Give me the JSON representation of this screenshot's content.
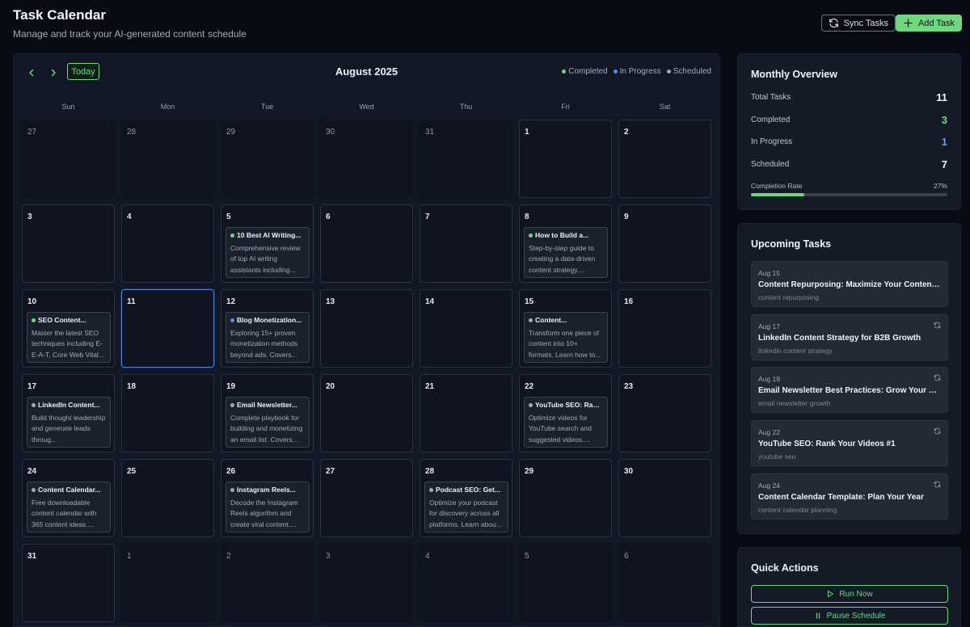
{
  "header": {
    "title": "Task Calendar",
    "subtitle": "Manage and track your AI-generated content schedule",
    "sync_label": "Sync Tasks",
    "add_label": "Add Task"
  },
  "calendar": {
    "month_label": "August 2025",
    "today_label": "Today",
    "legend": [
      {
        "label": "Completed",
        "color": "#6ed77f"
      },
      {
        "label": "In Progress",
        "color": "#5b8de0"
      },
      {
        "label": "Scheduled",
        "color": "#a3a9b5"
      }
    ],
    "weekdays": [
      "Sun",
      "Mon",
      "Tue",
      "Wed",
      "Thu",
      "Fri",
      "Sat"
    ],
    "days": [
      {
        "num": "27",
        "other": true
      },
      {
        "num": "28",
        "other": true
      },
      {
        "num": "29",
        "other": true
      },
      {
        "num": "30",
        "other": true
      },
      {
        "num": "31",
        "other": true
      },
      {
        "num": "1"
      },
      {
        "num": "2"
      },
      {
        "num": "3"
      },
      {
        "num": "4"
      },
      {
        "num": "5",
        "task": {
          "title": "10 Best AI Writing...",
          "desc": "Comprehensive review of top AI writing assistants including...",
          "status": "completed"
        }
      },
      {
        "num": "6"
      },
      {
        "num": "7"
      },
      {
        "num": "8",
        "task": {
          "title": "How to Build a...",
          "desc": "Step-by-step guide to creating a data-driven content strategy....",
          "status": "completed"
        }
      },
      {
        "num": "9"
      },
      {
        "num": "10",
        "task": {
          "title": "SEO Content...",
          "desc": "Master the latest SEO techniques including E-E-A-T, Core Web Vital...",
          "status": "completed"
        }
      },
      {
        "num": "11",
        "today": true
      },
      {
        "num": "12",
        "task": {
          "title": "Blog Monetization...",
          "desc": "Exploring 15+ proven monetization methods beyond ads. Covers...",
          "status": "in_progress"
        }
      },
      {
        "num": "13"
      },
      {
        "num": "14"
      },
      {
        "num": "15",
        "task": {
          "title": "Content...",
          "desc": "Transform one piece of content into 10+ formats. Learn how to...",
          "status": "scheduled"
        }
      },
      {
        "num": "16"
      },
      {
        "num": "17",
        "task": {
          "title": "LinkedIn Content...",
          "desc": "Build thought leadership and generate leads throug...",
          "status": "scheduled"
        }
      },
      {
        "num": "18"
      },
      {
        "num": "19",
        "task": {
          "title": "Email Newsletter...",
          "desc": "Complete playbook for building and monetizing an email list. Covers...",
          "status": "scheduled"
        }
      },
      {
        "num": "20"
      },
      {
        "num": "21"
      },
      {
        "num": "22",
        "task": {
          "title": "YouTube SEO: Rank...",
          "desc": "Optimize videos for YouTube search and suggested videos....",
          "status": "scheduled"
        }
      },
      {
        "num": "23"
      },
      {
        "num": "24",
        "task": {
          "title": "Content Calendar...",
          "desc": "Free downloadable content calendar with 365 content ideas....",
          "status": "scheduled"
        }
      },
      {
        "num": "25"
      },
      {
        "num": "26",
        "task": {
          "title": "Instagram Reels...",
          "desc": "Decode the Instagram Reels algorithm and create viral content....",
          "status": "scheduled"
        }
      },
      {
        "num": "27"
      },
      {
        "num": "28",
        "task": {
          "title": "Podcast SEO: Get...",
          "desc": "Optimize your podcast for discovery across all platforms. Learn abou...",
          "status": "scheduled"
        }
      },
      {
        "num": "29"
      },
      {
        "num": "30"
      },
      {
        "num": "31"
      },
      {
        "num": "1",
        "other": true
      },
      {
        "num": "2",
        "other": true
      },
      {
        "num": "3",
        "other": true
      },
      {
        "num": "4",
        "other": true
      },
      {
        "num": "5",
        "other": true
      },
      {
        "num": "6",
        "other": true
      }
    ]
  },
  "status_colors": {
    "completed": "#6ed77f",
    "in_progress": "#5b8de0",
    "scheduled": "#a3a9b5"
  },
  "overview": {
    "title": "Monthly Overview",
    "stats": [
      {
        "label": "Total Tasks",
        "value": "11",
        "color": "#f0f3f8"
      },
      {
        "label": "Completed",
        "value": "3",
        "color": "#6ed77f"
      },
      {
        "label": "In Progress",
        "value": "1",
        "color": "#6f9be8"
      },
      {
        "label": "Scheduled",
        "value": "7",
        "color": "#f0f3f8"
      }
    ],
    "rate_label": "Completion Rate",
    "rate_text": "27%",
    "rate_value": 0.27
  },
  "upcoming": {
    "title": "Upcoming Tasks",
    "items": [
      {
        "date": "Aug 15",
        "title": "Content Repurposing: Maximize Your Content ROI",
        "tag": "content repurposing",
        "icon": false
      },
      {
        "date": "Aug 17",
        "title": "LinkedIn Content Strategy for B2B Growth",
        "tag": "linkedin content strategy",
        "icon": true
      },
      {
        "date": "Aug 19",
        "title": "Email Newsletter Best Practices: Grow Your List ...",
        "tag": "email newsletter growth",
        "icon": true
      },
      {
        "date": "Aug 22",
        "title": "YouTube SEO: Rank Your Videos #1",
        "tag": "youtube seo",
        "icon": true
      },
      {
        "date": "Aug 24",
        "title": "Content Calendar Template: Plan Your Year",
        "tag": "content calendar planning",
        "icon": true
      }
    ]
  },
  "quick": {
    "title": "Quick Actions",
    "run_label": "Run Now",
    "pause_label": "Pause Schedule"
  }
}
